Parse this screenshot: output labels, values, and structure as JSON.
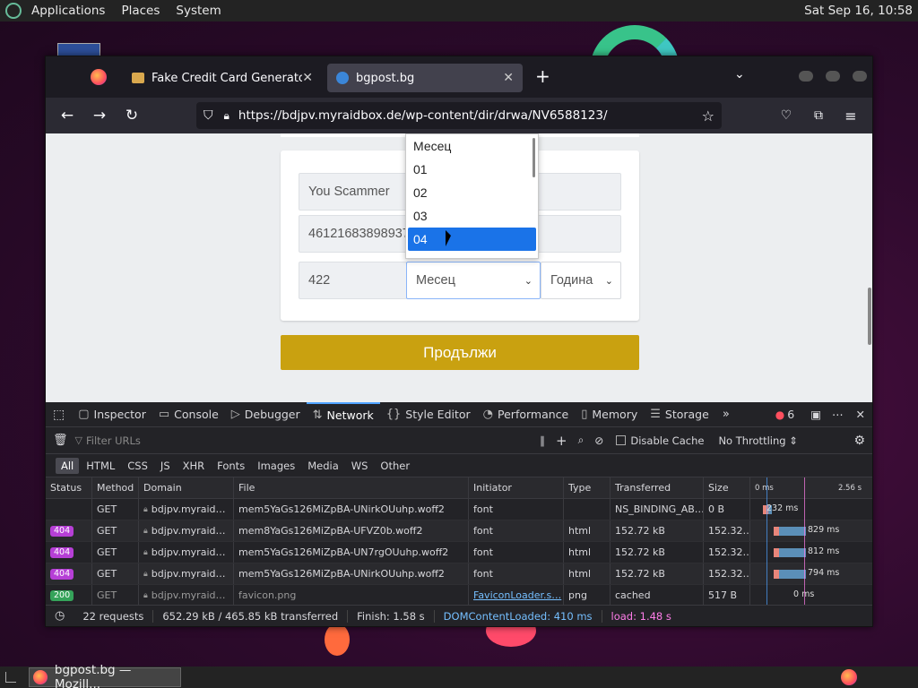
{
  "top_panel": {
    "menus": [
      "Applications",
      "Places",
      "System"
    ],
    "clock": "Sat Sep 16, 10:58"
  },
  "bottom_panel": {
    "task": "bgpost.bg — Mozill..."
  },
  "firefox": {
    "tabs": [
      {
        "label": "Fake Credit Card Generator"
      },
      {
        "label": "bgpost.bg"
      }
    ],
    "url": "https://bdjpv.myraidbox.de/wp-content/dir/drwa/NV6588123/"
  },
  "form": {
    "name_value": "You Scammer",
    "card_value": "46121683898937",
    "cvv_value": "422",
    "month_select": "Месец",
    "year_select": "Година",
    "continue_label": "Продължи",
    "month_options": [
      "Месец",
      "01",
      "02",
      "03",
      "04"
    ]
  },
  "devtools": {
    "tabs": [
      "Inspector",
      "Console",
      "Debugger",
      "Network",
      "Style Editor",
      "Performance",
      "Memory",
      "Storage"
    ],
    "error_count": "6",
    "filter_placeholder": "Filter URLs",
    "disable_cache": "Disable Cache",
    "throttling": "No Throttling ⇕",
    "types": [
      "All",
      "HTML",
      "CSS",
      "JS",
      "XHR",
      "Fonts",
      "Images",
      "Media",
      "WS",
      "Other"
    ],
    "columns": [
      "Status",
      "Method",
      "Domain",
      "File",
      "Initiator",
      "Type",
      "Transferred",
      "Size"
    ],
    "waterfall_start": "0 ms",
    "waterfall_end": "2.56 s",
    "rows": [
      {
        "status": "",
        "method": "GET",
        "domain": "bdjpv.myraid…",
        "file": "mem5YaGs126MiZpBA-UNirkOUuhp.woff2",
        "initiator": "font",
        "type": "",
        "transferred": "NS_BINDING_AB…",
        "size": "0 B",
        "timing": "232 ms"
      },
      {
        "status": "404",
        "method": "GET",
        "domain": "bdjpv.myraid…",
        "file": "mem8YaGs126MiZpBA-UFVZ0b.woff2",
        "initiator": "font",
        "type": "html",
        "transferred": "152.72 kB",
        "size": "152.32…",
        "timing": "829 ms"
      },
      {
        "status": "404",
        "method": "GET",
        "domain": "bdjpv.myraid…",
        "file": "mem5YaGs126MiZpBA-UN7rgOUuhp.woff2",
        "initiator": "font",
        "type": "html",
        "transferred": "152.72 kB",
        "size": "152.32…",
        "timing": "812 ms"
      },
      {
        "status": "404",
        "method": "GET",
        "domain": "bdjpv.myraid…",
        "file": "mem5YaGs126MiZpBA-UNirkOUuhp.woff2",
        "initiator": "font",
        "type": "html",
        "transferred": "152.72 kB",
        "size": "152.32…",
        "timing": "794 ms"
      },
      {
        "status": "200",
        "method": "GET",
        "domain": "bdjpv.myraid…",
        "file": "favicon.png",
        "initiator": "FaviconLoader.s…",
        "type": "png",
        "transferred": "cached",
        "size": "517 B",
        "timing": "0 ms"
      }
    ],
    "statusbar": {
      "requests": "22 requests",
      "transferred": "652.29 kB / 465.85 kB transferred",
      "finish": "Finish: 1.58 s",
      "dcl": "DOMContentLoaded: 410 ms",
      "load": "load: 1.48 s"
    }
  },
  "colors": {
    "accent": "#c9a110",
    "selection": "#1a73e8",
    "error": "#ff4f5e",
    "status404": "#b63fd6",
    "status200": "#35a35a"
  }
}
